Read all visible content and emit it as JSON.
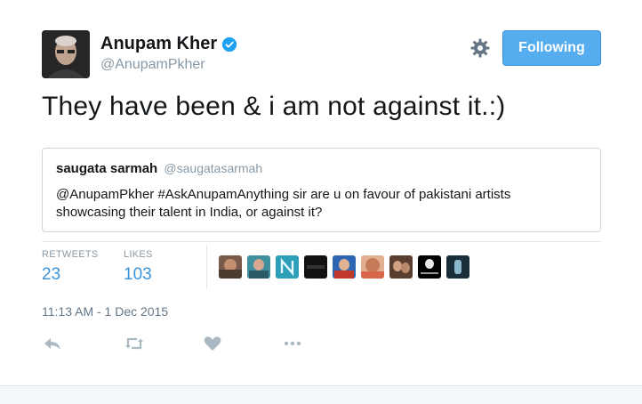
{
  "author": {
    "name": "Anupam Kher",
    "handle": "@AnupamPkher",
    "verified": true
  },
  "follow_button": {
    "label": "Following",
    "color": "#55acee"
  },
  "tweet": {
    "text": "They have been & i am not against it.:)"
  },
  "quoted_tweet": {
    "name": "saugata sarmah",
    "handle": "@saugatasarmah",
    "text": "@AnupamPkher #AskAnupamAnything sir are u on favour of pakistani artists showcasing their talent in India, or against it?"
  },
  "stats": {
    "retweets_label": "RETWEETS",
    "retweets_count": "23",
    "likes_label": "LIKES",
    "likes_count": "103"
  },
  "likers": [
    {
      "name": "liker-1"
    },
    {
      "name": "liker-2"
    },
    {
      "name": "liker-3"
    },
    {
      "name": "liker-4"
    },
    {
      "name": "liker-5"
    },
    {
      "name": "liker-6"
    },
    {
      "name": "liker-7"
    },
    {
      "name": "liker-8"
    },
    {
      "name": "liker-9"
    }
  ],
  "timestamp": "11:13 AM - 1 Dec 2015",
  "actions": [
    "reply-icon",
    "retweet-icon",
    "heart-icon",
    "more-icon"
  ],
  "colors": {
    "accent": "#55acee",
    "link_blue": "#3b94d9",
    "muted": "#8899a6",
    "border": "#e1e8ed"
  }
}
